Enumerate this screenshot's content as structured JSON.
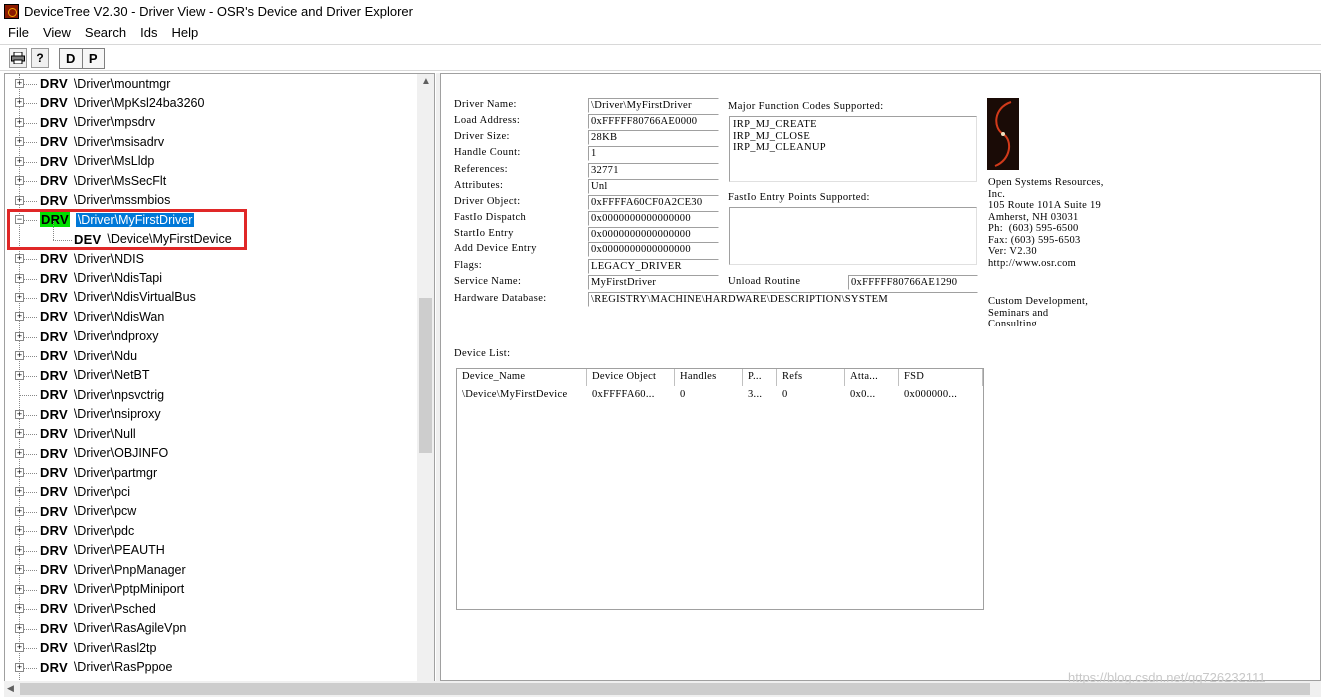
{
  "window": {
    "title": "DeviceTree V2.30 - Driver View - OSR's Device and Driver Explorer"
  },
  "menu": [
    "File",
    "View",
    "Search",
    "Ids",
    "Help"
  ],
  "toolbar": {
    "print_icon": "printer-icon",
    "help_icon": "help-icon",
    "help_glyph": "?",
    "d_label": "D",
    "p_label": "P"
  },
  "tree": {
    "items": [
      {
        "tag": "DRV",
        "path": "\\Driver\\mountmgr",
        "expander": "+"
      },
      {
        "tag": "DRV",
        "path": "\\Driver\\MpKsl24ba3260",
        "expander": "+"
      },
      {
        "tag": "DRV",
        "path": "\\Driver\\mpsdrv",
        "expander": "+"
      },
      {
        "tag": "DRV",
        "path": "\\Driver\\msisadrv",
        "expander": "+"
      },
      {
        "tag": "DRV",
        "path": "\\Driver\\MsLldp",
        "expander": "+"
      },
      {
        "tag": "DRV",
        "path": "\\Driver\\MsSecFlt",
        "expander": "+"
      },
      {
        "tag": "DRV",
        "path": "\\Driver\\mssmbios",
        "expander": "+"
      },
      {
        "tag": "DRV",
        "path": "\\Driver\\MyFirstDriver",
        "expander": "−",
        "selected": true
      },
      {
        "tag": "DEV",
        "path": "\\Device\\MyFirstDevice",
        "expander": "",
        "child": true
      },
      {
        "tag": "DRV",
        "path": "\\Driver\\NDIS",
        "expander": "+"
      },
      {
        "tag": "DRV",
        "path": "\\Driver\\NdisTapi",
        "expander": "+"
      },
      {
        "tag": "DRV",
        "path": "\\Driver\\NdisVirtualBus",
        "expander": "+"
      },
      {
        "tag": "DRV",
        "path": "\\Driver\\NdisWan",
        "expander": "+"
      },
      {
        "tag": "DRV",
        "path": "\\Driver\\ndproxy",
        "expander": "+"
      },
      {
        "tag": "DRV",
        "path": "\\Driver\\Ndu",
        "expander": "+"
      },
      {
        "tag": "DRV",
        "path": "\\Driver\\NetBT",
        "expander": "+"
      },
      {
        "tag": "DRV",
        "path": "\\Driver\\npsvctrig",
        "expander": ""
      },
      {
        "tag": "DRV",
        "path": "\\Driver\\nsiproxy",
        "expander": "+"
      },
      {
        "tag": "DRV",
        "path": "\\Driver\\Null",
        "expander": "+"
      },
      {
        "tag": "DRV",
        "path": "\\Driver\\OBJINFO",
        "expander": "+"
      },
      {
        "tag": "DRV",
        "path": "\\Driver\\partmgr",
        "expander": "+"
      },
      {
        "tag": "DRV",
        "path": "\\Driver\\pci",
        "expander": "+"
      },
      {
        "tag": "DRV",
        "path": "\\Driver\\pcw",
        "expander": "+"
      },
      {
        "tag": "DRV",
        "path": "\\Driver\\pdc",
        "expander": "+"
      },
      {
        "tag": "DRV",
        "path": "\\Driver\\PEAUTH",
        "expander": "+"
      },
      {
        "tag": "DRV",
        "path": "\\Driver\\PnpManager",
        "expander": "+"
      },
      {
        "tag": "DRV",
        "path": "\\Driver\\PptpMiniport",
        "expander": "+"
      },
      {
        "tag": "DRV",
        "path": "\\Driver\\Psched",
        "expander": "+"
      },
      {
        "tag": "DRV",
        "path": "\\Driver\\RasAgileVpn",
        "expander": "+"
      },
      {
        "tag": "DRV",
        "path": "\\Driver\\Rasl2tp",
        "expander": "+"
      },
      {
        "tag": "DRV",
        "path": "\\Driver\\RasPppoe",
        "expander": "+"
      }
    ]
  },
  "details": {
    "fields": [
      {
        "label": "Driver Name:",
        "value": "\\Driver\\MyFirstDriver"
      },
      {
        "label": "Load Address:",
        "value": "0xFFFFF80766AE0000"
      },
      {
        "label": "Driver Size:",
        "value": "28KB"
      },
      {
        "label": "Handle Count:",
        "value": "1"
      },
      {
        "label": "References:",
        "value": "32771"
      },
      {
        "label": "Attributes:",
        "value": "Unl"
      },
      {
        "label": "Driver Object:",
        "value": "0xFFFFA60CF0A2CE30"
      },
      {
        "label": "FastIo Dispatch",
        "value": "0x0000000000000000"
      },
      {
        "label": "StartIo Entry",
        "value": "0x0000000000000000"
      },
      {
        "label": "Add Device Entry",
        "value": "0x0000000000000000"
      },
      {
        "label": "Flags:",
        "value": "LEGACY_DRIVER"
      },
      {
        "label": "Service Name:",
        "value": "MyFirstDriver"
      }
    ],
    "hardware_database_label": "Hardware Database:",
    "hardware_database_value": "\\REGISTRY\\MACHINE\\HARDWARE\\DESCRIPTION\\SYSTEM",
    "major_function_label": "Major Function Codes Supported:",
    "major_functions": [
      "IRP_MJ_CREATE",
      "IRP_MJ_CLOSE",
      "IRP_MJ_CLEANUP"
    ],
    "fastio_label": "FastIo Entry Points Supported:",
    "unload_label": "Unload Routine",
    "unload_value": "0xFFFFF80766AE1290",
    "osr_info": "Open Systems Resources,\nInc.\n105 Route 101A Suite 19\nAmherst, NH 03031\nPh:  (603) 595-6500\nFax: (603) 595-6503\nVer: V2.30\nhttp://www.osr.com",
    "osr_info2": "Custom Development,\nSeminars and\nConsulting",
    "device_list_label": "Device List:",
    "device_list": {
      "columns": [
        "Device_Name",
        "Device Object",
        "Handles",
        "P...",
        "Refs",
        "Atta...",
        "FSD"
      ],
      "rows": [
        [
          "\\Device\\MyFirstDevice",
          "0xFFFFA60...",
          "0",
          "3...",
          "0",
          "0x0...",
          "0x000000..."
        ]
      ]
    }
  },
  "watermark": "https://blog.csdn.net/qq726232111",
  "colors": {
    "selection": "#0078d7",
    "drv_highlight": "#00e000",
    "annotation_box": "#e02828"
  }
}
